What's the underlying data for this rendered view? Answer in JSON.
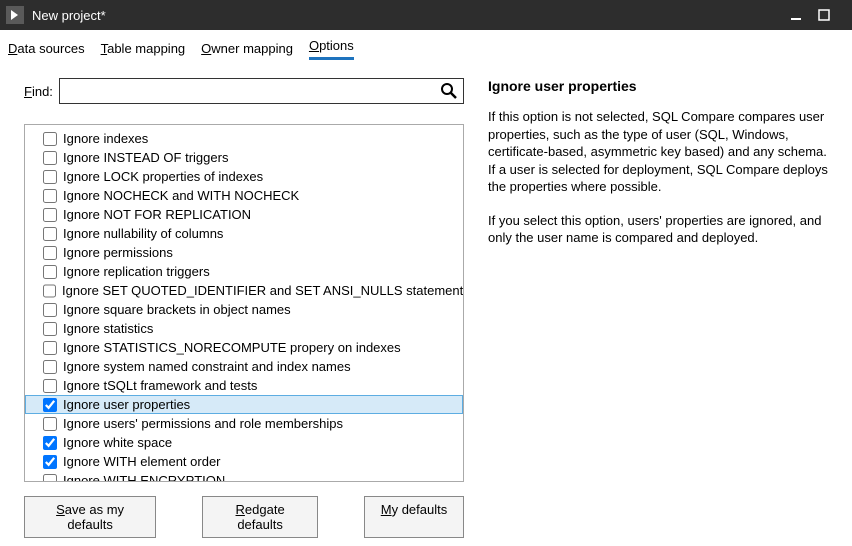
{
  "titlebar": {
    "title": "New project*"
  },
  "tabs": [
    {
      "label": "Data sources",
      "ul": "D"
    },
    {
      "label": "Table mapping",
      "ul": "T"
    },
    {
      "label": "Owner mapping",
      "ul": "O"
    },
    {
      "label": "Options",
      "ul": "O",
      "active": true
    }
  ],
  "find": {
    "label": "Find:",
    "value": ""
  },
  "options": [
    {
      "label": "Ignore indexes",
      "checked": false
    },
    {
      "label": "Ignore INSTEAD OF triggers",
      "checked": false
    },
    {
      "label": "Ignore LOCK properties of indexes",
      "checked": false
    },
    {
      "label": "Ignore NOCHECK and WITH NOCHECK",
      "checked": false
    },
    {
      "label": "Ignore NOT FOR REPLICATION",
      "checked": false
    },
    {
      "label": "Ignore nullability of columns",
      "checked": false
    },
    {
      "label": "Ignore permissions",
      "checked": false
    },
    {
      "label": "Ignore replication triggers",
      "checked": false
    },
    {
      "label": "Ignore SET QUOTED_IDENTIFIER and SET ANSI_NULLS statements",
      "checked": false
    },
    {
      "label": "Ignore square brackets in object names",
      "checked": false
    },
    {
      "label": "Ignore statistics",
      "checked": false
    },
    {
      "label": "Ignore STATISTICS_NORECOMPUTE propery on indexes",
      "checked": false
    },
    {
      "label": "Ignore system named constraint and index names",
      "checked": false
    },
    {
      "label": "Ignore tSQLt framework and tests",
      "checked": false
    },
    {
      "label": "Ignore user properties",
      "checked": true,
      "selected": true
    },
    {
      "label": "Ignore users' permissions and role memberships",
      "checked": false
    },
    {
      "label": "Ignore white space",
      "checked": true
    },
    {
      "label": "Ignore WITH element order",
      "checked": true
    },
    {
      "label": "Ignore WITH ENCRYPTION",
      "checked": false
    }
  ],
  "buttons": {
    "save_defaults": "Save as my defaults",
    "redgate_defaults": "Redgate defaults",
    "my_defaults": "My defaults"
  },
  "detail": {
    "title": "Ignore user properties",
    "p1": "If this option is not selected, SQL Compare compares user properties, such as the type of user (SQL, Windows, certificate-based, asymmetric key based) and any schema. If a user is selected for deployment, SQL Compare deploys the properties where possible.",
    "p2": "If you select this option, users' properties are ignored, and only the user name is compared and deployed."
  }
}
